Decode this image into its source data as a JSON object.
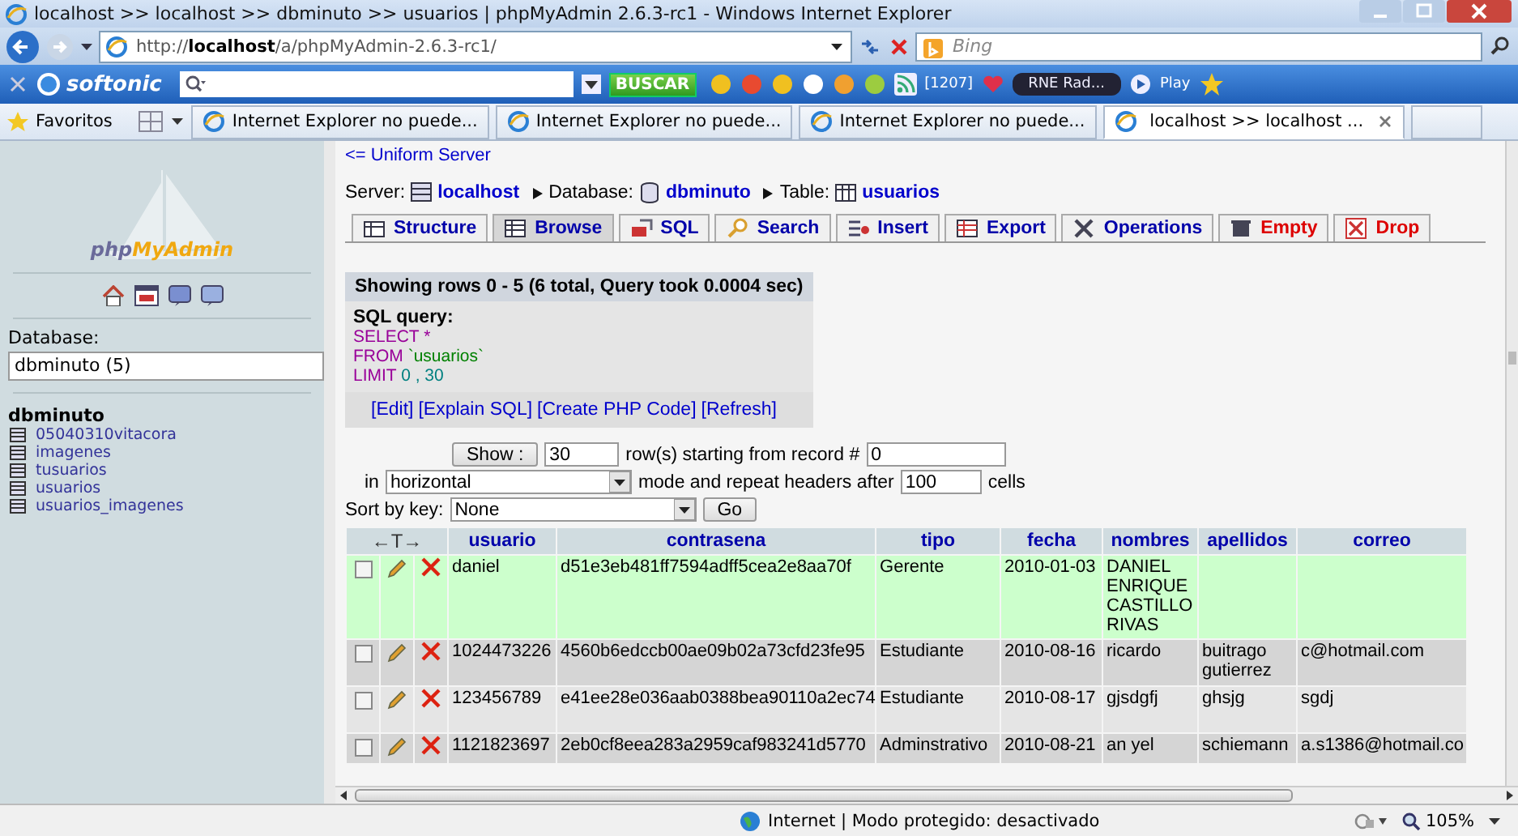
{
  "window": {
    "title": "localhost >> localhost >> dbminuto >> usuarios | phpMyAdmin 2.6.3-rc1 - Windows Internet Explorer"
  },
  "address_bar": {
    "url": "http://**localhost**/a/phpMyAdmin-2.6.3-rc1/",
    "search_placeholder": "Bing"
  },
  "toolbar": {
    "brand": "softonic",
    "search_button": "BUSCAR",
    "counter": "[1207]",
    "radio": "RNE Rad...",
    "play": "Play"
  },
  "favorites": {
    "label": "Favoritos",
    "tabs": [
      {
        "label": "Internet Explorer no puede...",
        "selected": false
      },
      {
        "label": "Internet Explorer no puede...",
        "selected": false
      },
      {
        "label": "Internet Explorer no puede...",
        "selected": false
      },
      {
        "label": "localhost >> localhost ...",
        "selected": true
      }
    ]
  },
  "sidebar": {
    "logo": "phpMyAdmin",
    "database_label": "Database:",
    "database_value": "dbminuto (5)",
    "db_title": "dbminuto",
    "tables": [
      "05040310vitacora",
      "imagenes",
      "tusuarios",
      "usuarios",
      "usuarios_imagenes"
    ]
  },
  "main": {
    "back_link": "<= Uniform Server",
    "breadcrumb": [
      {
        "label": "Server:",
        "value": "localhost"
      },
      {
        "label": "Database:",
        "value": "dbminuto"
      },
      {
        "label": "Table:",
        "value": "usuarios"
      }
    ],
    "tabs": [
      {
        "label": "Structure",
        "selected": false,
        "kind": "normal"
      },
      {
        "label": "Browse",
        "selected": true,
        "kind": "normal"
      },
      {
        "label": "SQL",
        "selected": false,
        "kind": "normal"
      },
      {
        "label": "Search",
        "selected": false,
        "kind": "normal"
      },
      {
        "label": "Insert",
        "selected": false,
        "kind": "normal"
      },
      {
        "label": "Export",
        "selected": false,
        "kind": "normal"
      },
      {
        "label": "Operations",
        "selected": false,
        "kind": "normal"
      },
      {
        "label": "Empty",
        "selected": false,
        "kind": "danger"
      },
      {
        "label": "Drop",
        "selected": false,
        "kind": "danger"
      }
    ],
    "result": {
      "summary": "Showing rows 0 - 5 (6 total, Query took 0.0004 sec)",
      "sql_label": "SQL query:",
      "sql": [
        [
          {
            "text": "SELECT *",
            "kind": "keyword"
          }
        ],
        [
          {
            "text": "FROM",
            "kind": "keyword"
          },
          {
            "text": " `usuarios`",
            "kind": "string"
          }
        ],
        [
          {
            "text": "LIMIT",
            "kind": "keyword"
          },
          {
            "text": " 0 , 30",
            "kind": "number"
          }
        ]
      ],
      "links": [
        "[Edit]",
        "[Explain SQL]",
        "[Create PHP Code]",
        "[Refresh]"
      ]
    },
    "navigation": {
      "show_button": "Show :",
      "rows": "30",
      "rows_text": "row(s) starting from record #",
      "start": "0",
      "in_text": "in",
      "mode": "horizontal",
      "mode_text": "mode and repeat headers after",
      "repeat": "100",
      "cells_text": "cells",
      "sort_label": "Sort by key:",
      "sort_value": "None",
      "go_button": "Go"
    },
    "table": {
      "arrows": "←T→",
      "columns": [
        "usuario",
        "contrasena",
        "tipo",
        "fecha",
        "nombres",
        "apellidos",
        "correo"
      ],
      "rows": [
        {
          "highlighted": true,
          "checked": false,
          "cells": [
            "daniel",
            "d51e3eb481ff7594adff5cea2e8aa70f",
            "Gerente",
            "2010-01-03",
            "DANIEL ENRIQUE CASTILLO RIVAS",
            "",
            " "
          ]
        },
        {
          "highlighted": false,
          "checked": false,
          "cells": [
            "1024473226",
            "4560b6edccb00ae09b02a73cfd23fe95",
            "Estudiante",
            "2010-08-16",
            "ricardo",
            "buitrago gutierrez",
            "c@hotmail.com"
          ]
        },
        {
          "highlighted": false,
          "checked": false,
          "cells": [
            "123456789",
            "e41ee28e036aab0388bea90110a2ec74",
            "Estudiante",
            "2010-08-17",
            "gjsdgfj",
            "ghsjg",
            "sgdj"
          ]
        },
        {
          "highlighted": false,
          "checked": false,
          "cells": [
            "1121823697",
            "2eb0cf8eea283a2959caf983241d5770",
            "Adminstrativo",
            "2010-08-21",
            "an yel",
            "schiemann",
            "a.s1386@hotmail.co"
          ]
        }
      ]
    }
  },
  "status_bar": {
    "text": "Internet | Modo protegido: desactivado",
    "zoom": "105%"
  }
}
